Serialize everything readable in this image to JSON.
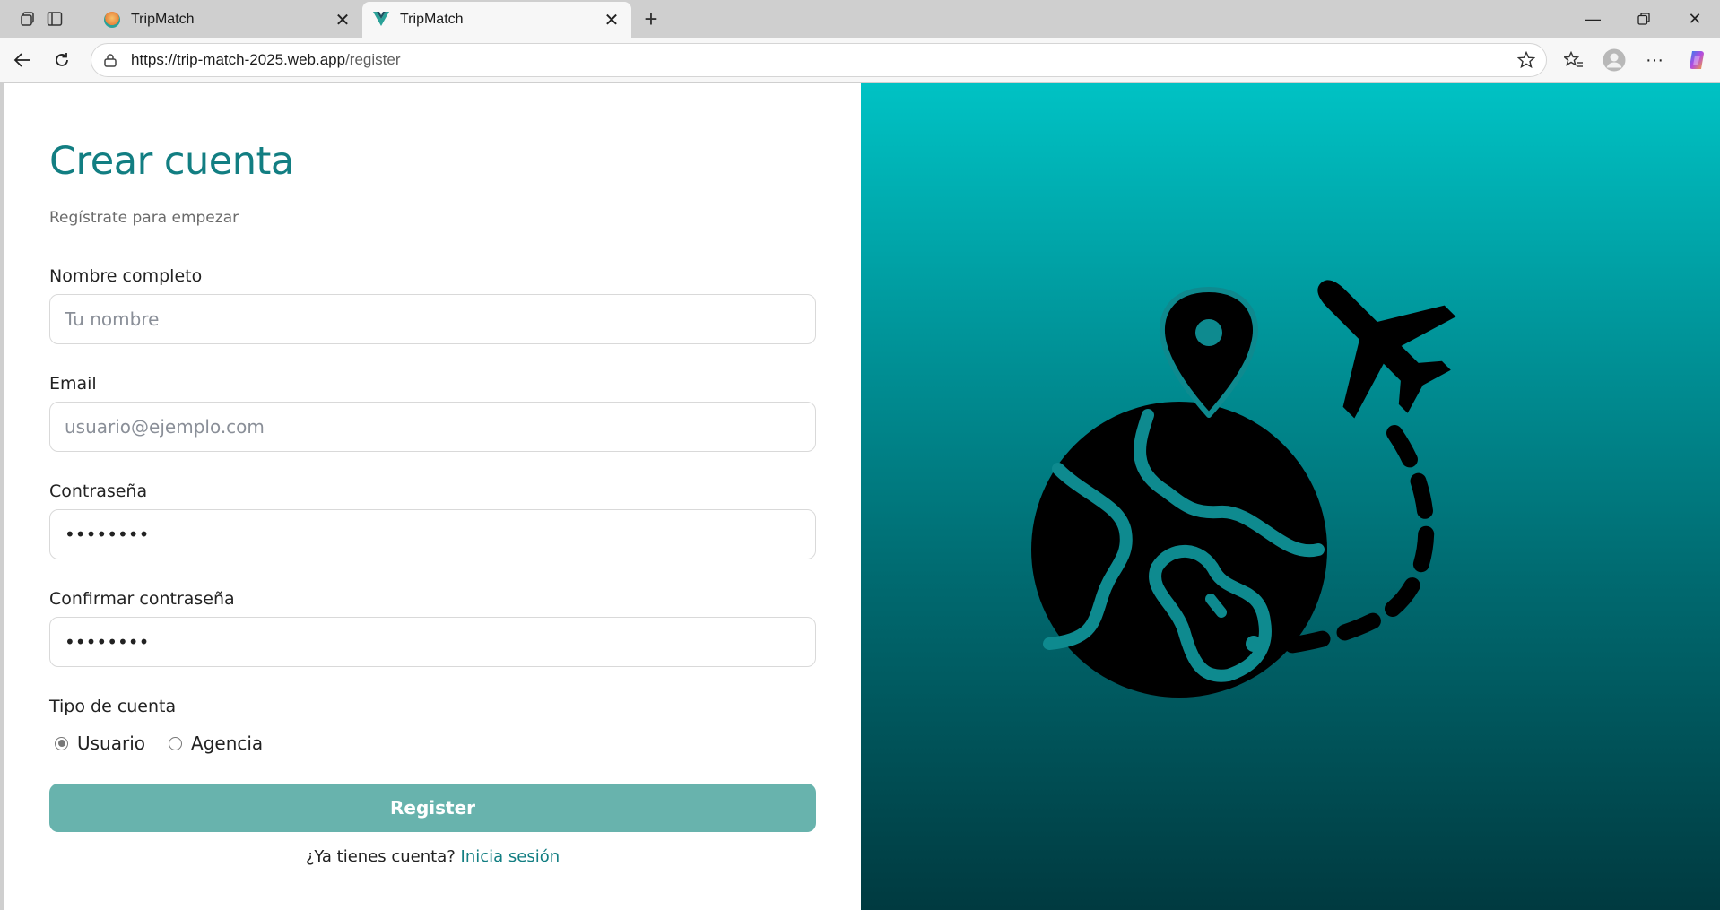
{
  "browser": {
    "tabs": [
      {
        "title": "TripMatch",
        "active": false,
        "favicon_color": "#e8843b"
      },
      {
        "title": "TripMatch",
        "active": true,
        "favicon_color": "#2aa198"
      }
    ],
    "url_host": "https://trip-match-2025.web.app",
    "url_path": "/register"
  },
  "form": {
    "title": "Crear cuenta",
    "subtitle": "Regístrate para empezar",
    "name_label": "Nombre completo",
    "name_placeholder": "Tu nombre",
    "email_label": "Email",
    "email_placeholder": "usuario@ejemplo.com",
    "password_label": "Contraseña",
    "password_value": "••••••••",
    "confirm_label": "Confirmar contraseña",
    "confirm_value": "••••••••",
    "account_type_label": "Tipo de cuenta",
    "account_types": [
      {
        "label": "Usuario",
        "selected": true
      },
      {
        "label": "Agencia",
        "selected": false
      }
    ],
    "submit_label": "Register",
    "signin_prompt": "¿Ya tienes cuenta?",
    "signin_link": "Inicia sesión"
  },
  "colors": {
    "accent": "#127e82",
    "button": "#68b3ad",
    "gradient_top": "#00c2c4",
    "gradient_bottom": "#003a40"
  },
  "illustration": {
    "icons": [
      "globe-icon",
      "map-pin-icon",
      "airplane-icon"
    ]
  }
}
